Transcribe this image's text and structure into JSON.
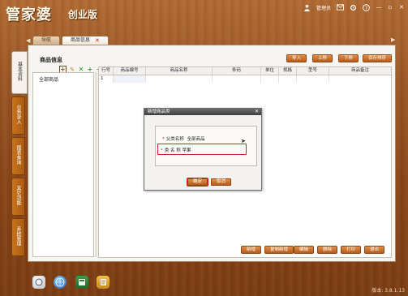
{
  "app": {
    "title_main": "管家婆",
    "title_sub": "创业版"
  },
  "topbar": {
    "user_label": "管理员",
    "icons": [
      "user-icon",
      "mail-icon",
      "settings-icon",
      "help-icon"
    ],
    "window_buttons": [
      "minimize",
      "maximize",
      "close"
    ]
  },
  "tabs": [
    {
      "label": "导航",
      "active": false
    },
    {
      "label": "商品信息",
      "active": true,
      "closable": true
    }
  ],
  "left_menu": [
    {
      "label": "基本资料",
      "active": true
    },
    {
      "label": "业务录入",
      "active": false
    },
    {
      "label": "报表查询",
      "active": false
    },
    {
      "label": "其它功能",
      "active": false
    },
    {
      "label": "系统管理",
      "active": false
    }
  ],
  "panel": {
    "title": "商品信息",
    "top_buttons": [
      "导入",
      "上移",
      "下移",
      "保存排序"
    ],
    "tree_root": "全部商品",
    "columns": [
      "行号",
      "商品编号",
      "商品名称",
      "条码",
      "单位",
      "规格",
      "型号",
      "商品备注"
    ],
    "rows": [
      {
        "row_no": "1",
        "code": "",
        "name": "",
        "barcode": "",
        "unit": "",
        "spec": "",
        "model": "",
        "note": ""
      }
    ],
    "bottom_buttons": [
      "新增",
      "复制新增",
      "编辑",
      "删除",
      "打印",
      "退出"
    ]
  },
  "dialog": {
    "title": "新增商品类",
    "parent_label": "父类名称",
    "parent_value": "全部商品",
    "name_label": "类 名 称",
    "name_value": "苹果",
    "ok_label": "确定",
    "cancel_label": "取消"
  },
  "taskbar": {
    "icons": [
      "start-icon",
      "browser-icon",
      "calculator-icon",
      "notepad-icon"
    ]
  },
  "version": "版本: 3.8.1.13",
  "colors": {
    "accent": "#c8741b",
    "highlight_border": "#d42020",
    "wood": "#9a5524"
  }
}
